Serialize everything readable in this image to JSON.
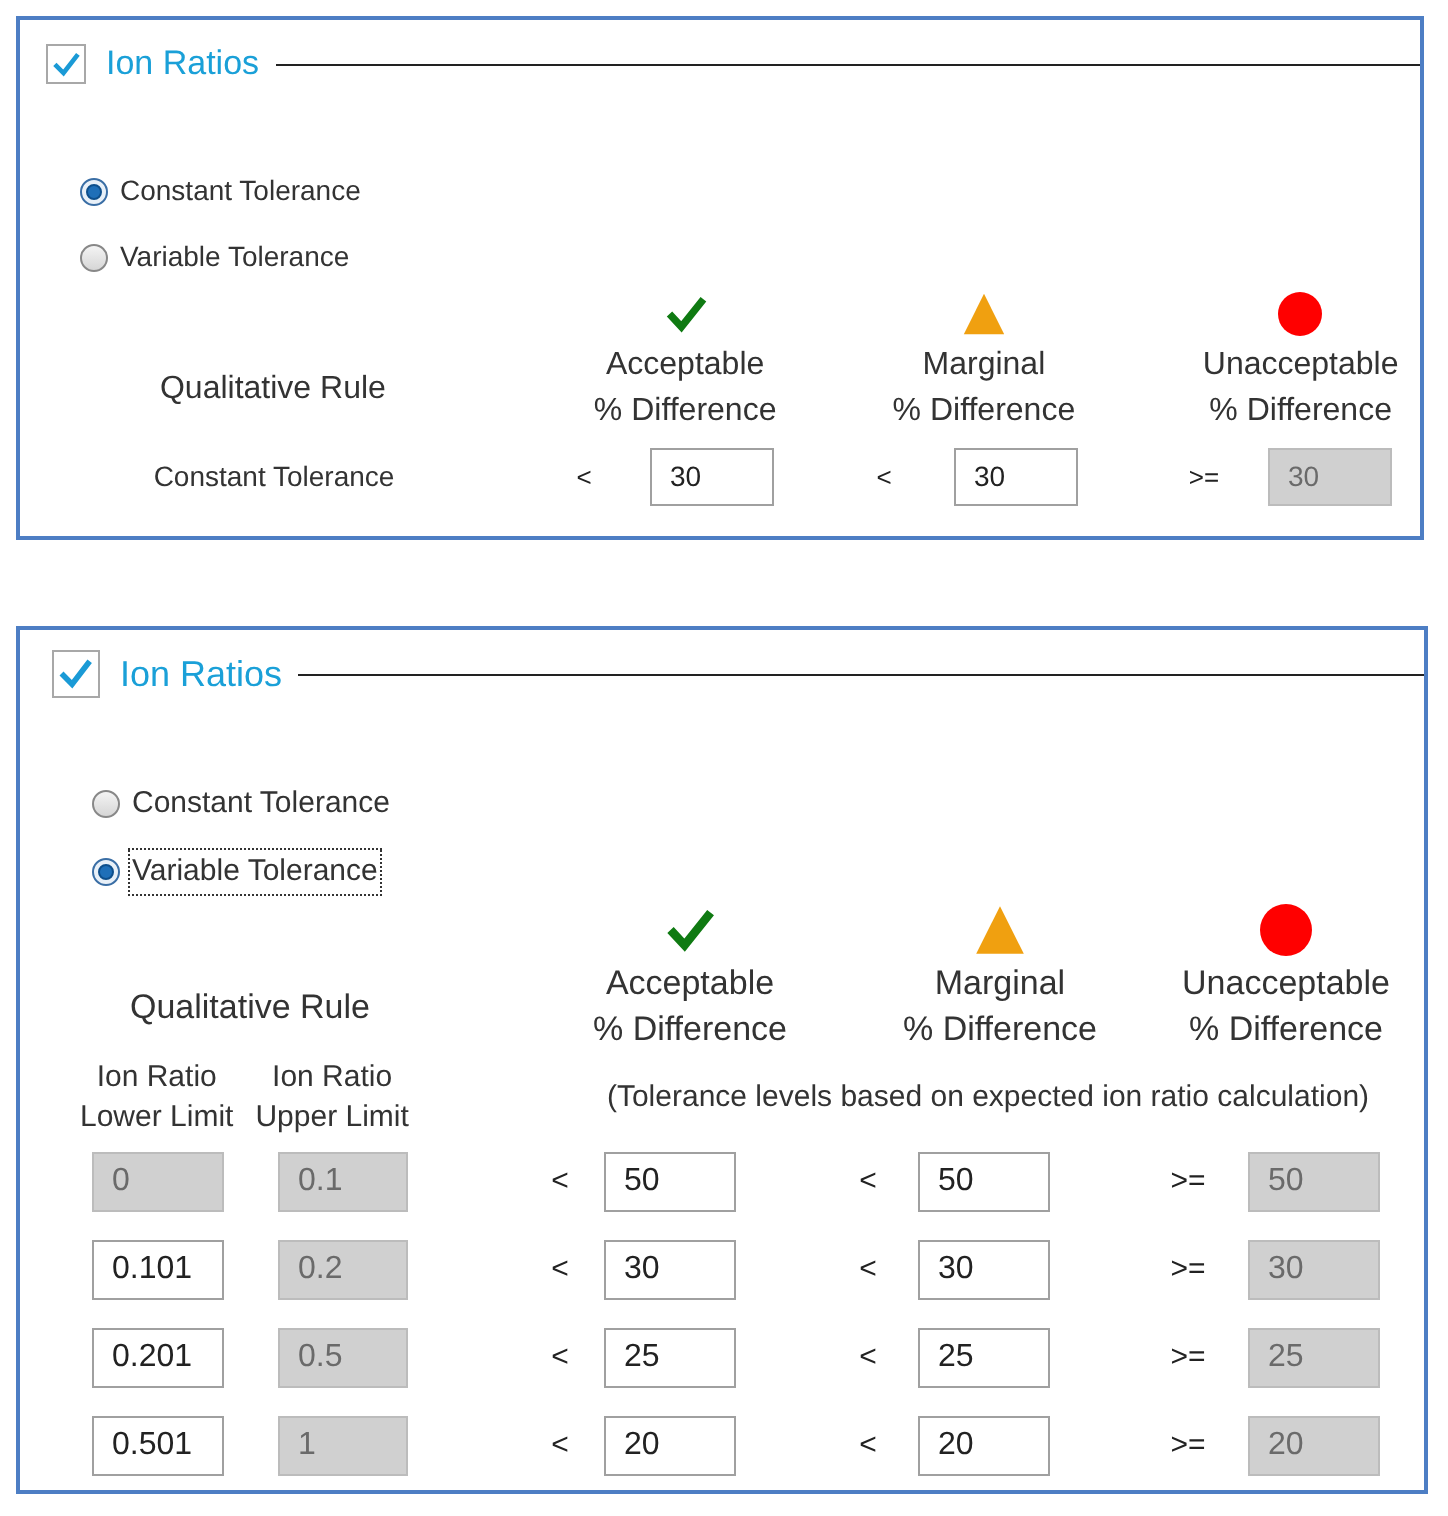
{
  "panels": [
    {
      "kind": "compact",
      "title": "Ion Ratios",
      "checked": true,
      "options": [
        {
          "label": "Constant Tolerance",
          "selected": true,
          "focused": false
        },
        {
          "label": "Variable Tolerance",
          "selected": false,
          "focused": false
        }
      ],
      "rule_heading": "Qualitative Rule",
      "levels": [
        {
          "kind": "acceptable",
          "label": "Acceptable",
          "sublabel": "% Difference"
        },
        {
          "kind": "marginal",
          "label": "Marginal",
          "sublabel": "% Difference"
        },
        {
          "kind": "unacceptable",
          "label": "Unacceptable",
          "sublabel": "% Difference"
        }
      ],
      "rows": [
        {
          "label": "Constant Tolerance",
          "cells": [
            {
              "op": "<",
              "value": "30",
              "disabled": false
            },
            {
              "op": "<",
              "value": "30",
              "disabled": false
            },
            {
              "op": ">=",
              "value": "30",
              "disabled": true
            }
          ]
        }
      ]
    },
    {
      "kind": "large",
      "title": "Ion Ratios",
      "checked": true,
      "options": [
        {
          "label": "Constant Tolerance",
          "selected": false,
          "focused": false
        },
        {
          "label": "Variable Tolerance",
          "selected": true,
          "focused": true
        }
      ],
      "rule_heading": "Qualitative Rule",
      "levels": [
        {
          "kind": "acceptable",
          "label": "Acceptable",
          "sublabel": "% Difference"
        },
        {
          "kind": "marginal",
          "label": "Marginal",
          "sublabel": "% Difference"
        },
        {
          "kind": "unacceptable",
          "label": "Unacceptable",
          "sublabel": "% Difference"
        }
      ],
      "limit_headings": [
        {
          "label": "Ion Ratio",
          "sublabel": "Lower Limit"
        },
        {
          "label": "Ion Ratio",
          "sublabel": "Upper Limit"
        }
      ],
      "note": "(Tolerance levels based on expected ion ratio calculation)",
      "rows": [
        {
          "lower": {
            "value": "0",
            "disabled": true
          },
          "upper": {
            "value": "0.1",
            "disabled": true
          },
          "cells": [
            {
              "op": "<",
              "value": "50",
              "disabled": false
            },
            {
              "op": "<",
              "value": "50",
              "disabled": false
            },
            {
              "op": ">=",
              "value": "50",
              "disabled": true
            }
          ]
        },
        {
          "lower": {
            "value": "0.101",
            "disabled": false
          },
          "upper": {
            "value": "0.2",
            "disabled": true
          },
          "cells": [
            {
              "op": "<",
              "value": "30",
              "disabled": false
            },
            {
              "op": "<",
              "value": "30",
              "disabled": false
            },
            {
              "op": ">=",
              "value": "30",
              "disabled": true
            }
          ]
        },
        {
          "lower": {
            "value": "0.201",
            "disabled": false
          },
          "upper": {
            "value": "0.5",
            "disabled": true
          },
          "cells": [
            {
              "op": "<",
              "value": "25",
              "disabled": false
            },
            {
              "op": "<",
              "value": "25",
              "disabled": false
            },
            {
              "op": ">=",
              "value": "25",
              "disabled": true
            }
          ]
        },
        {
          "lower": {
            "value": "0.501",
            "disabled": false
          },
          "upper": {
            "value": "1",
            "disabled": true
          },
          "cells": [
            {
              "op": "<",
              "value": "20",
              "disabled": false
            },
            {
              "op": "<",
              "value": "20",
              "disabled": false
            },
            {
              "op": ">=",
              "value": "20",
              "disabled": true
            }
          ]
        }
      ]
    }
  ]
}
